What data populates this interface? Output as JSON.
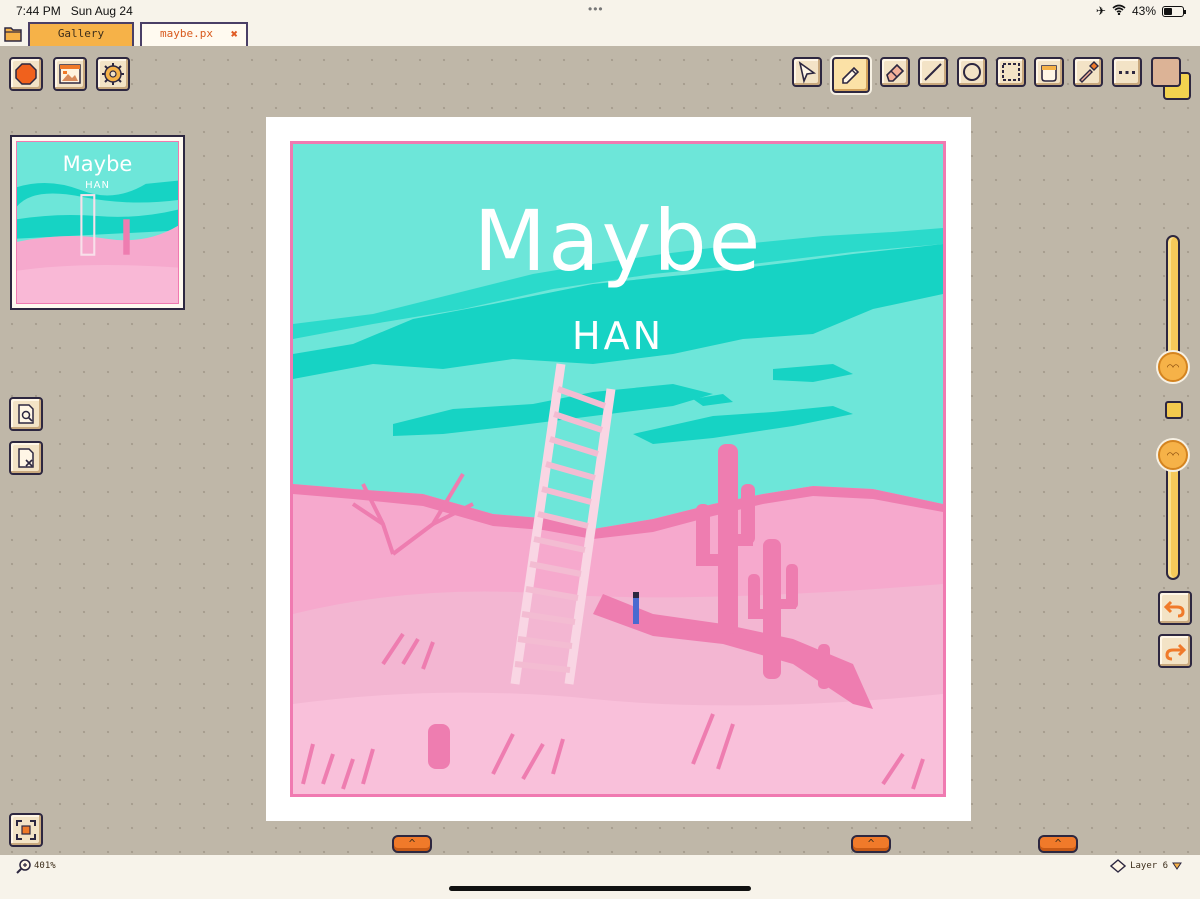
{
  "status_bar": {
    "time": "7:44 PM",
    "date": "Sun Aug 24",
    "battery": "43%",
    "dots": "•••"
  },
  "tabs": {
    "gallery_label": "Gallery",
    "file_label": "maybe.px",
    "close_glyph": "✖"
  },
  "artwork": {
    "title": "Maybe",
    "artist": "HAN"
  },
  "preview": {
    "title": "Maybe",
    "artist": "HAN"
  },
  "tools": [
    "select-tool-icon",
    "pencil-tool-icon",
    "eraser-tool-icon",
    "line-tool-icon",
    "ellipse-tool-icon",
    "marquee-tool-icon",
    "fill-tool-icon",
    "eyedropper-tool-icon",
    "more-tools-icon"
  ],
  "colors": {
    "primary": "#dcb396",
    "secondary": "#f3d34f",
    "accent": "#f6b248",
    "sky": "#6de6d9",
    "ground": "#f6a9cd"
  },
  "left_tools": [
    "menu-icon",
    "reference-image-icon",
    "settings-gear-icon"
  ],
  "sliders": {
    "brush_size_level": 0.4,
    "opacity_level": 0.05
  },
  "bottom_bar": {
    "zoom": "401%",
    "layer": "Layer 6"
  }
}
